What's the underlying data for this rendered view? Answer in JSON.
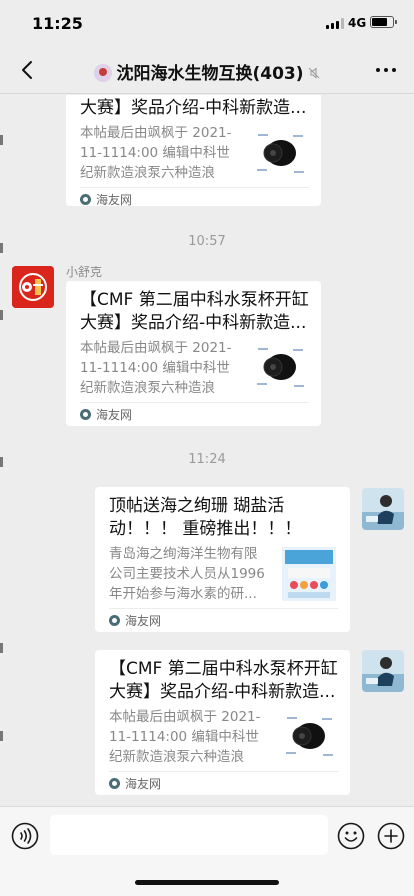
{
  "status_bar": {
    "time": "11:25",
    "network": "4G"
  },
  "nav": {
    "title": "沈阳海水生物互换(403)"
  },
  "messages": [
    {
      "title": "大赛】奖品介绍-中科新款造...",
      "desc": "本帖最后由飒枫于 2021-11-1114:00 编辑中科世纪新款造浪泵六种造浪模...",
      "source": "海友网"
    },
    {
      "time": "10:57",
      "sender": "小舒克",
      "title": "【CMF 第二届中科水泵杯开缸大赛】奖品介绍-中科新款造...",
      "desc": "本帖最后由飒枫于 2021-11-1114:00 编辑中科世纪新款造浪泵六种造浪模...",
      "source": "海友网"
    },
    {
      "time": "11:24",
      "title": "顶帖送海之绚珊 瑚盐活动！！！ 重磅推出！！！",
      "desc": "青岛海之绚海洋生物有限公司主要技术人员从1996年开始参与海水素的研...",
      "source": "海友网"
    },
    {
      "title": "【CMF 第二届中科水泵杯开缸大赛】奖品介绍-中科新款造...",
      "desc": "本帖最后由飒枫于 2021-11-1114:00 编辑中科世纪新款造浪泵六种造浪模...",
      "source": "海友网"
    }
  ],
  "input": {
    "value": ""
  },
  "icons": {
    "back": "chevron-left-icon",
    "mute": "mute-icon",
    "more": "more-icon",
    "voice": "voice-icon",
    "emoji": "emoji-icon",
    "plus": "plus-icon"
  },
  "colors": {
    "background": "#ededed",
    "card": "#ffffff",
    "avatar_red": "#d9251b"
  }
}
